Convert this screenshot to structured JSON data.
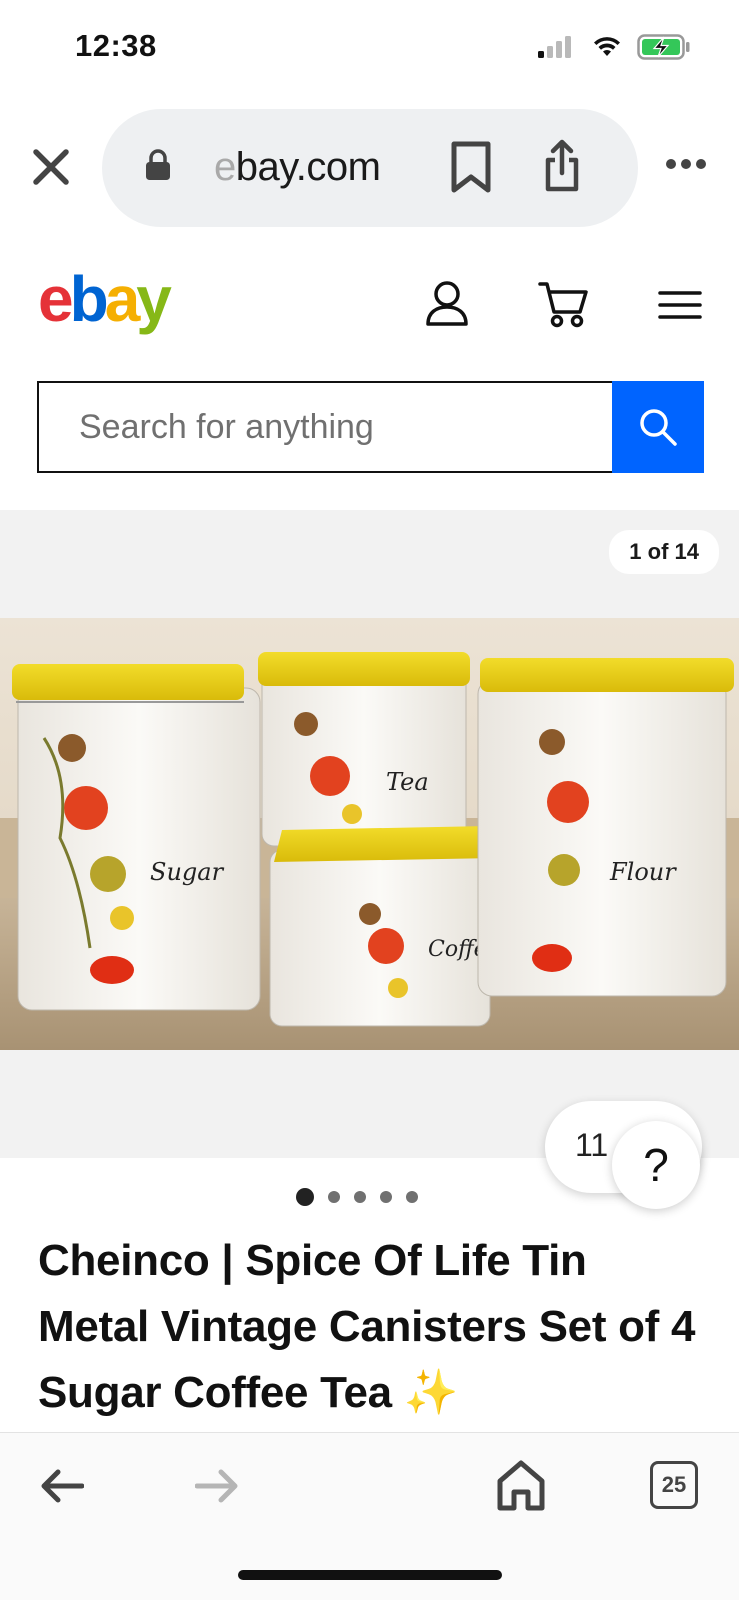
{
  "status_bar": {
    "time": "12:38"
  },
  "browser": {
    "url_faded": "e",
    "url_text": "bay.com"
  },
  "ebay": {
    "logo_letters": [
      "e",
      "b",
      "a",
      "y"
    ],
    "brand_colors": {
      "red": "#e53238",
      "blue": "#0064d2",
      "yellow": "#f5af02",
      "green": "#86b817"
    },
    "search_placeholder": "Search for anything",
    "search_button_color": "#0064ff"
  },
  "gallery": {
    "counter": "1 of 14",
    "current_index": 1,
    "total": 14,
    "visible_dots": 5,
    "active_dot": 0,
    "photo_labels": [
      "Sugar",
      "Tea",
      "Coffee",
      "Flour"
    ]
  },
  "help": {
    "count": "11",
    "question": "?"
  },
  "listing": {
    "title": "Cheinco | Spice Of Life Tin Metal Vintage Canisters Set of 4 Sugar Coffee Tea ✨"
  },
  "toolbar": {
    "tabs_count": "25"
  }
}
